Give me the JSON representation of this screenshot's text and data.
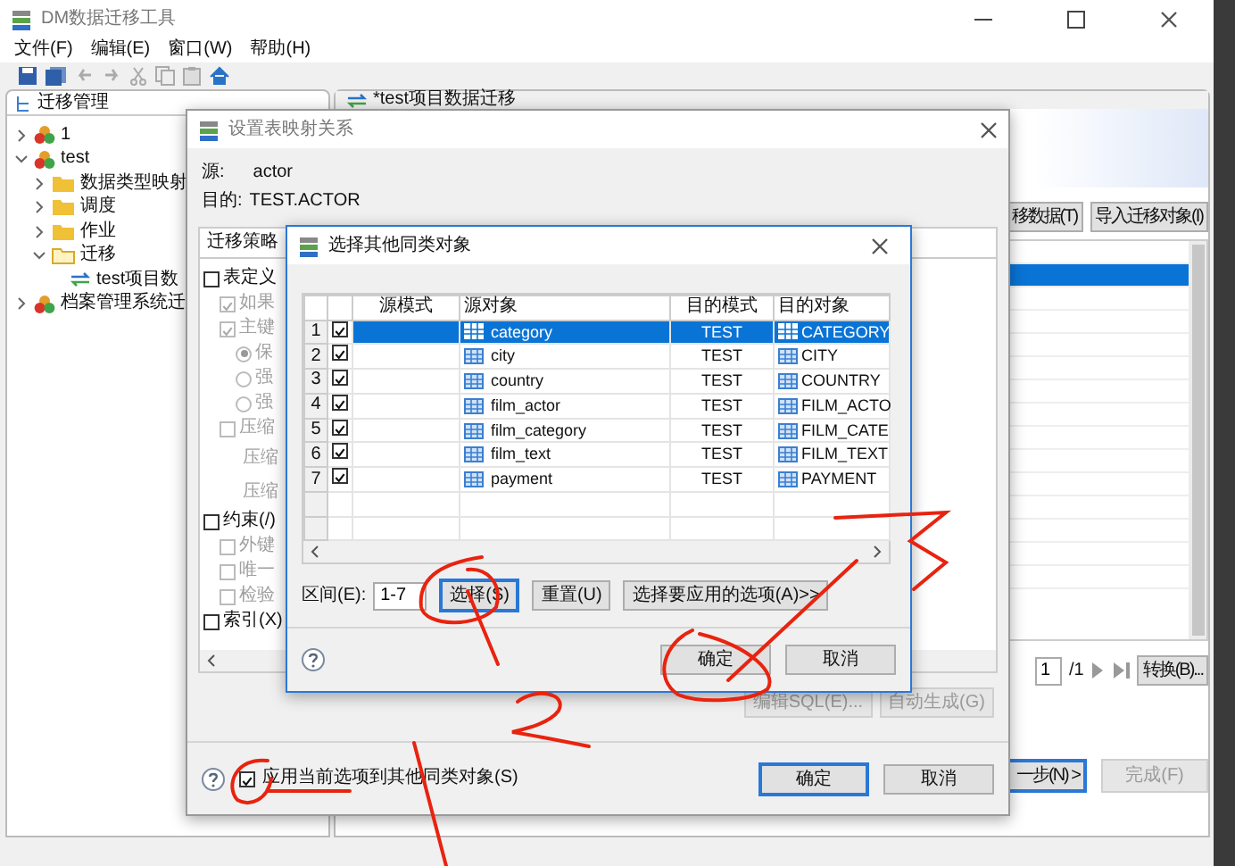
{
  "app": {
    "title": "DM数据迁移工具"
  },
  "menu": [
    "文件(F)",
    "编辑(E)",
    "窗口(W)",
    "帮助(H)"
  ],
  "left_panel": {
    "tab": "迁移管理",
    "tree": [
      {
        "label": "1",
        "kind": "project",
        "expanded": false
      },
      {
        "label": "test",
        "kind": "project",
        "expanded": true,
        "children": [
          {
            "label": "数据类型映射",
            "kind": "folder",
            "expanded": false
          },
          {
            "label": "调度",
            "kind": "folder",
            "expanded": false
          },
          {
            "label": "作业",
            "kind": "folder",
            "expanded": false
          },
          {
            "label": "迁移",
            "kind": "folder",
            "expanded": true,
            "children": [
              {
                "label": "test项目数",
                "kind": "migration"
              }
            ]
          }
        ]
      },
      {
        "label": "档案管理系统迁",
        "kind": "project",
        "expanded": false
      }
    ]
  },
  "editor": {
    "tab": "*test项目数据迁移",
    "buttons": [
      "移数据(T)",
      "导入迁移对象(I)"
    ],
    "page": "1",
    "page_total": "/1",
    "convert_button": "转换(B)...",
    "next_button": {
      "label": "一步(N) >",
      "default": true
    },
    "finish_button": {
      "label": "完成(F)",
      "disabled": true
    }
  },
  "mapping_dialog": {
    "title": "设置表映射关系",
    "source_label": "源:",
    "source": "actor",
    "target_label": "目的:",
    "target": "TEST.ACTOR",
    "group_tab": "迁移策略",
    "options": [
      {
        "kind": "checkbox",
        "label": "表定义",
        "checked": false,
        "disabled": false,
        "children": [
          {
            "kind": "checkbox",
            "label": "如果",
            "checked": true,
            "disabled": true
          },
          {
            "kind": "checkbox",
            "label": "主键",
            "checked": true,
            "disabled": true,
            "children": [
              {
                "kind": "radio",
                "label": "保",
                "selected": true,
                "disabled": true
              },
              {
                "kind": "radio",
                "label": "强",
                "selected": false,
                "disabled": true
              },
              {
                "kind": "radio",
                "label": "强",
                "selected": false,
                "disabled": true
              }
            ]
          },
          {
            "kind": "checkbox",
            "label": "压缩",
            "checked": false,
            "disabled": true,
            "children": [
              {
                "kind": "label",
                "label": "压缩",
                "disabled": true
              },
              {
                "kind": "label",
                "label": "压缩",
                "disabled": true
              }
            ]
          }
        ]
      },
      {
        "kind": "checkbox",
        "label": "约束(/)",
        "checked": false,
        "disabled": false,
        "children": [
          {
            "kind": "checkbox",
            "label": "外键",
            "checked": false,
            "disabled": true
          },
          {
            "kind": "checkbox",
            "label": "唯一",
            "checked": false,
            "disabled": true
          },
          {
            "kind": "checkbox",
            "label": "检验",
            "checked": false,
            "disabled": true
          }
        ]
      },
      {
        "kind": "checkbox",
        "label": "索引(X)",
        "checked": false,
        "disabled": false
      }
    ],
    "sql_buttons": [
      {
        "label": "编辑SQL(E)...",
        "disabled": true
      },
      {
        "label": "自动生成(G)",
        "disabled": true
      }
    ],
    "apply_checkbox": {
      "label": "应用当前选项到其他同类对象(S)",
      "checked": true
    },
    "buttons": [
      {
        "label": "确定",
        "default": true
      },
      {
        "label": "取消",
        "default": false
      }
    ]
  },
  "select_dialog": {
    "title": "选择其他同类对象",
    "columns": [
      "源模式",
      "源对象",
      "目的模式",
      "目的对象"
    ],
    "rows": [
      {
        "num": "1",
        "checked": true,
        "source_object": "category",
        "target_schema": "TEST",
        "target_object": "CATEGORY",
        "selected": true
      },
      {
        "num": "2",
        "checked": true,
        "source_object": "city",
        "target_schema": "TEST",
        "target_object": "CITY",
        "selected": false
      },
      {
        "num": "3",
        "checked": true,
        "source_object": "country",
        "target_schema": "TEST",
        "target_object": "COUNTRY",
        "selected": false
      },
      {
        "num": "4",
        "checked": true,
        "source_object": "film_actor",
        "target_schema": "TEST",
        "target_object": "FILM_ACTO",
        "selected": false
      },
      {
        "num": "5",
        "checked": true,
        "source_object": "film_category",
        "target_schema": "TEST",
        "target_object": "FILM_CATE",
        "selected": false
      },
      {
        "num": "6",
        "checked": true,
        "source_object": "film_text",
        "target_schema": "TEST",
        "target_object": "FILM_TEXT",
        "selected": false
      },
      {
        "num": "7",
        "checked": true,
        "source_object": "payment",
        "target_schema": "TEST",
        "target_object": "PAYMENT",
        "selected": false
      }
    ],
    "range_label": "区间(E):",
    "range": "1-7",
    "buttons": [
      {
        "label": "选择(S)",
        "default": true
      },
      {
        "label": "重置(U)",
        "default": false
      },
      {
        "label": "选择要应用的选项(A)>>",
        "default": false
      }
    ],
    "footer_buttons": [
      {
        "label": "确定",
        "default": false
      },
      {
        "label": "取消",
        "default": false
      }
    ]
  }
}
